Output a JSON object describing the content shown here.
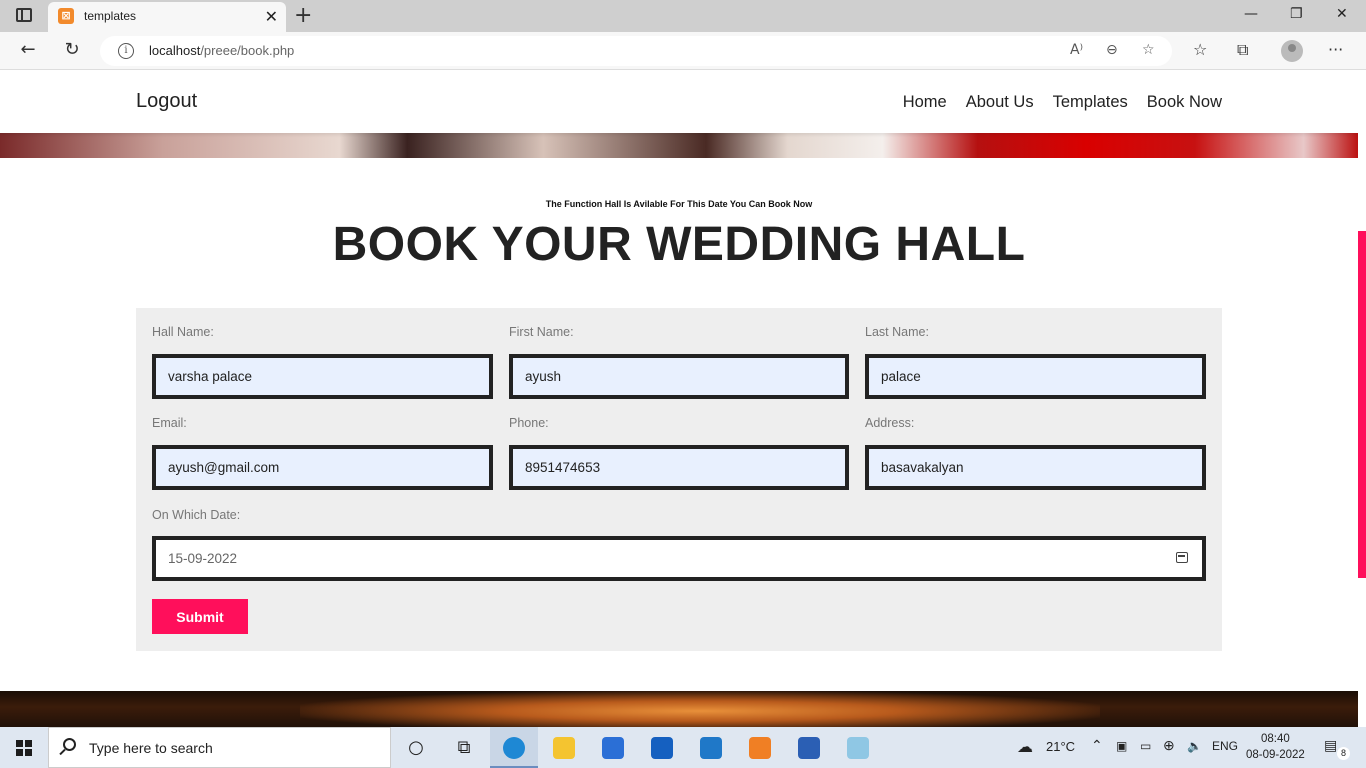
{
  "browser": {
    "tab_title": "templates",
    "url_host": "localhost",
    "url_path": "/preee/book.php",
    "read_aloud": "A⁾",
    "favorites_add": "☆",
    "collections": "⧉",
    "more": "···"
  },
  "site": {
    "logout": "Logout",
    "nav": [
      "Home",
      "About Us",
      "Templates",
      "Book Now"
    ],
    "subtitle": "The Function Hall Is Avilable For This Date You Can Book Now",
    "title": "BOOK YOUR WEDDING HALL"
  },
  "form": {
    "hall_name_label": "Hall Name:",
    "hall_name_value": "varsha palace",
    "first_name_label": "First Name:",
    "first_name_value": "ayush",
    "last_name_label": "Last Name:",
    "last_name_value": "palace",
    "email_label": "Email:",
    "email_value": "ayush@gmail.com",
    "phone_label": "Phone:",
    "phone_value": "8951474653",
    "address_label": "Address:",
    "address_value": "basavakalyan",
    "date_label": "On Which Date:",
    "date_value": "15-09-2022",
    "submit_label": "Submit"
  },
  "taskbar": {
    "search_placeholder": "Type here to search",
    "weather": "21°C",
    "language": "ENG",
    "time": "08:40",
    "date": "08-09-2022",
    "notification_count": "8"
  },
  "colors": {
    "accent": "#ff0f5b",
    "input_fill": "#e8f0fe",
    "panel": "#eeeeee"
  }
}
